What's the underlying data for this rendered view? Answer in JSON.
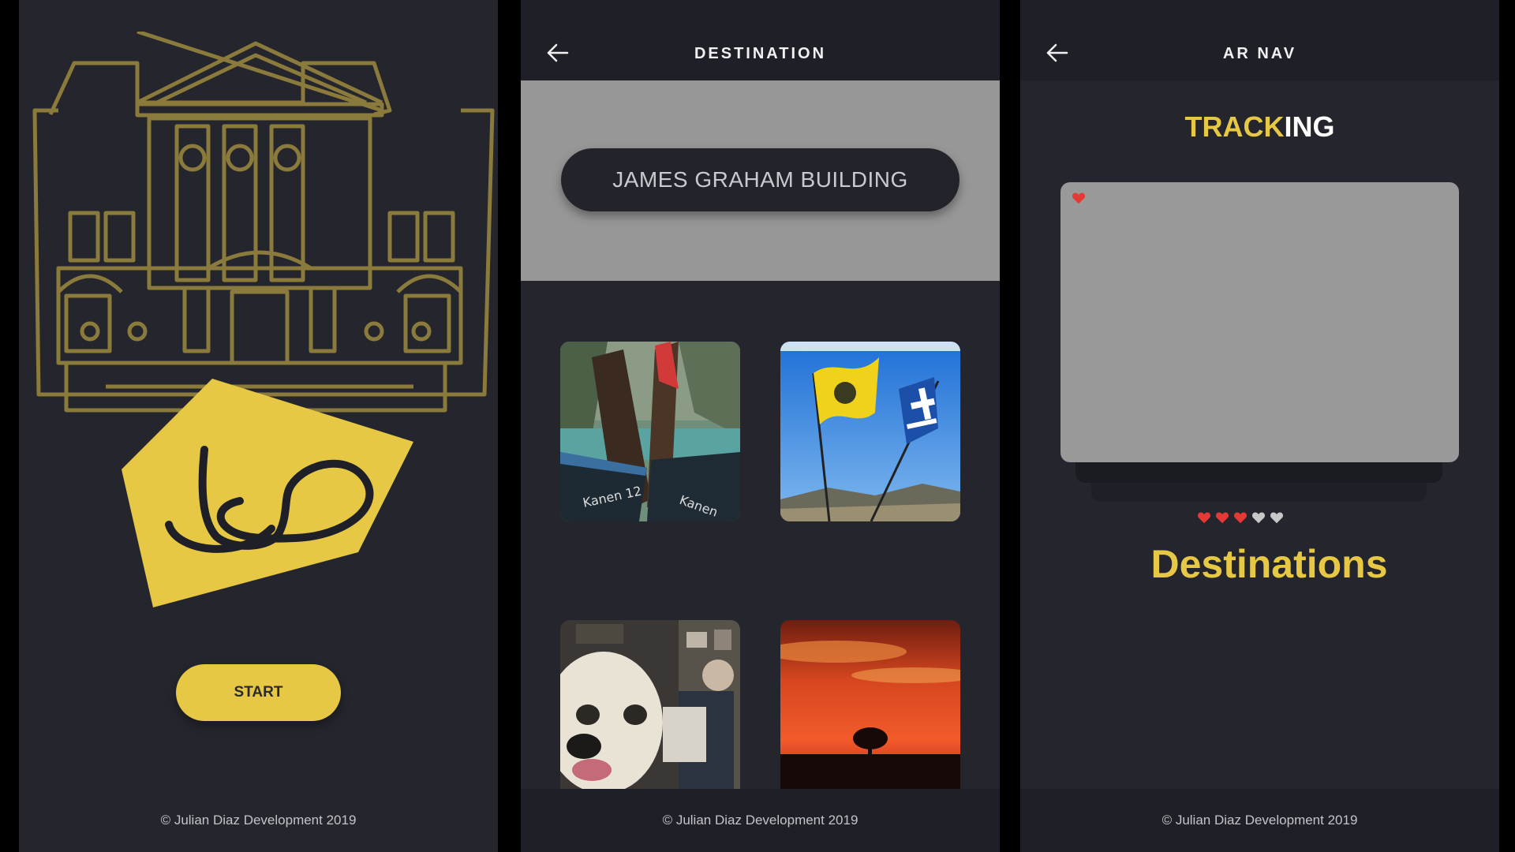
{
  "colors": {
    "accent": "#e6c845",
    "panel_bg": "#25262d",
    "appbar_bg": "#1f2027",
    "heart_red": "#e53935",
    "heart_grey": "#c8c8c8"
  },
  "screen_start": {
    "start_label": "START",
    "footer": "© Julian Diaz Development 2019"
  },
  "screen_destination": {
    "title": "DESTINATION",
    "back_icon": "arrow-left-icon",
    "destination_value": "JAMES GRAHAM BUILDING",
    "photos": [
      "longtail-boats-photo",
      "greek-flags-photo",
      "dog-and-man-photo",
      "sunset-tree-photo"
    ],
    "footer": "© Julian Diaz Development 2019"
  },
  "screen_arnav": {
    "title": "AR NAV",
    "back_icon": "arrow-left-icon",
    "tracking_part1": "TRACK",
    "tracking_part2": "ING",
    "rating": {
      "filled": 3,
      "total": 5
    },
    "destinations_label": "Destinations",
    "footer": "© Julian Diaz Development 2019"
  }
}
